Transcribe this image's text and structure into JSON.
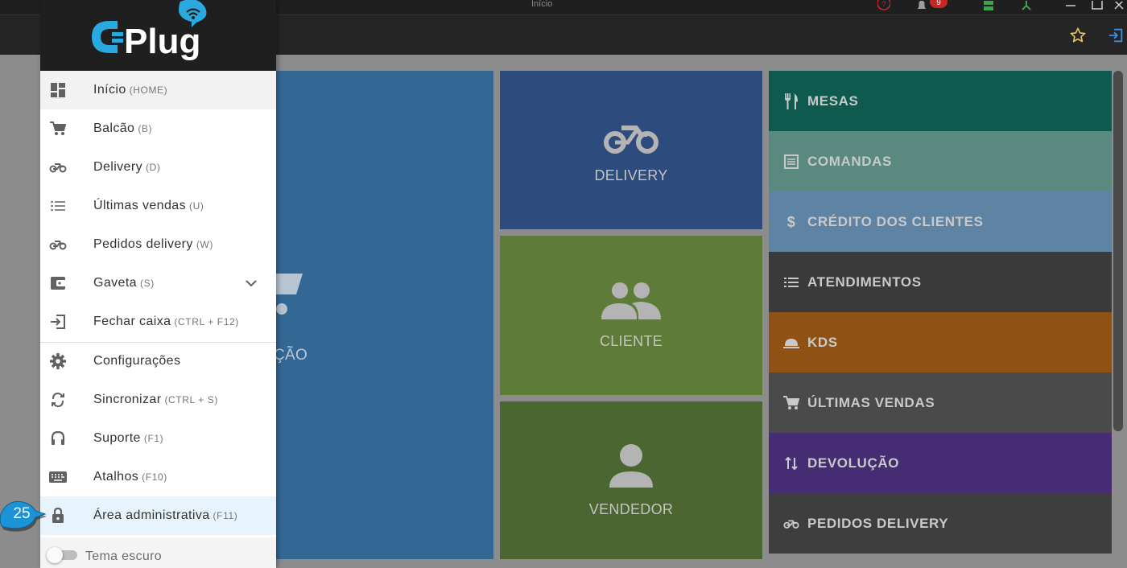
{
  "window": {
    "title": "Início",
    "notification_count": "9"
  },
  "drawer": {
    "logo_text": "CPlug",
    "items": [
      {
        "label": "Início",
        "shortcut": "(HOME)"
      },
      {
        "label": "Balcão",
        "shortcut": "(B)"
      },
      {
        "label": "Delivery",
        "shortcut": "(D)"
      },
      {
        "label": "Últimas vendas",
        "shortcut": "(U)"
      },
      {
        "label": "Pedidos delivery",
        "shortcut": "(W)"
      },
      {
        "label": "Gaveta",
        "shortcut": "(S)"
      },
      {
        "label": "Fechar caixa",
        "shortcut": "(CTRL + F12)"
      },
      {
        "label": "Configurações",
        "shortcut": ""
      },
      {
        "label": "Sincronizar",
        "shortcut": "(CTRL + S)"
      },
      {
        "label": "Suporte",
        "shortcut": "(F1)"
      },
      {
        "label": "Atalhos",
        "shortcut": "(F10)"
      },
      {
        "label": "Área administrativa",
        "shortcut": "(F11)"
      }
    ],
    "theme_label": "Tema escuro"
  },
  "tiles": {
    "big_partial_label": "ÇÃO",
    "delivery": "DELIVERY",
    "cliente": "CLIENTE",
    "vendedor": "VENDEDOR"
  },
  "right_list": [
    {
      "label": "MESAS",
      "color": "#0f5a4f"
    },
    {
      "label": "COMANDAS",
      "color": "#5a8a7f"
    },
    {
      "label": "CRÉDITO DOS CLIENTES",
      "color": "#5e83a3"
    },
    {
      "label": "ATENDIMENTOS",
      "color": "#3a3a3a"
    },
    {
      "label": "KDS",
      "color": "#8f5214"
    },
    {
      "label": "ÚLTIMAS VENDAS",
      "color": "#4a4a4a"
    },
    {
      "label": "DEVOLUÇÃO",
      "color": "#462c72"
    },
    {
      "label": "PEDIDOS DELIVERY",
      "color": "#3e3e3e"
    }
  ],
  "callout_number": "25"
}
